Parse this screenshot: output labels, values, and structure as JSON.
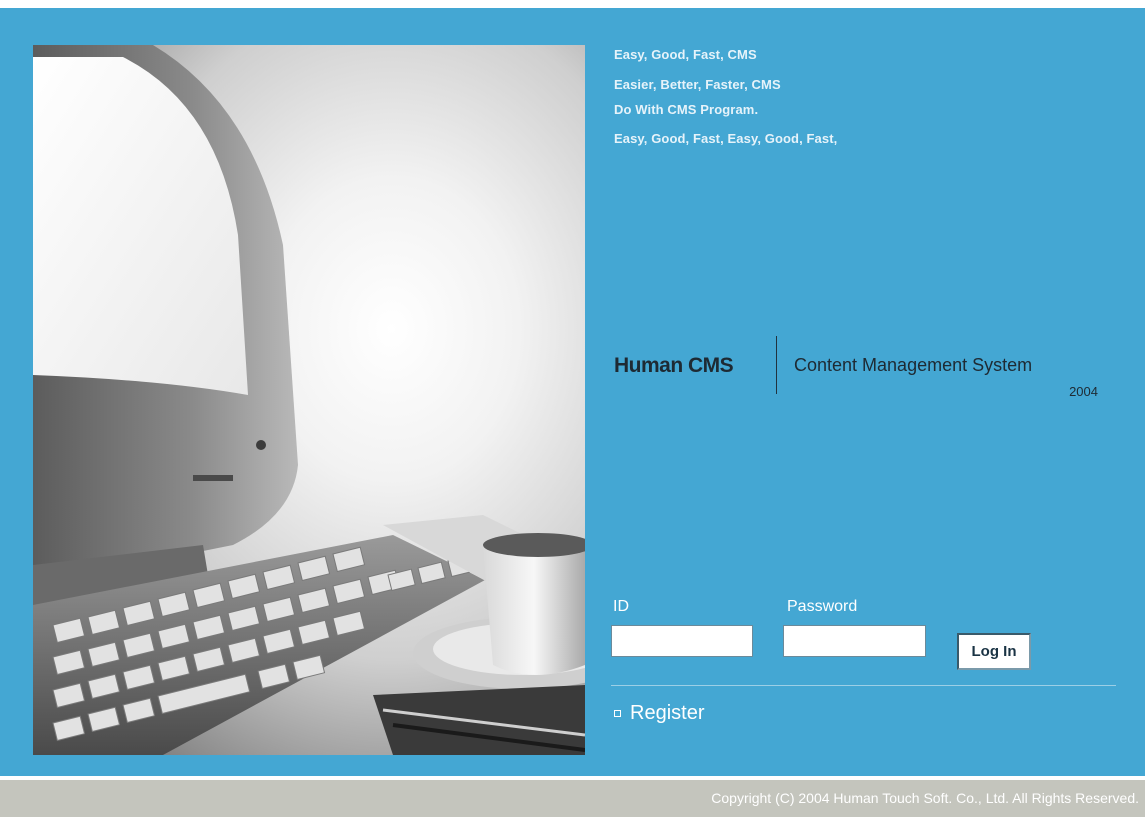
{
  "taglines": [
    "Easy, Good, Fast,  CMS",
    "Easier, Better, Faster,  CMS",
    "Do With CMS Program.",
    "Easy, Good, Fast,  Easy, Good, Fast,"
  ],
  "brand": {
    "name": "Human CMS",
    "subtitle": "Content Management System",
    "year": "2004"
  },
  "login": {
    "id_label": "ID",
    "id_value": "",
    "password_label": "Password",
    "password_value": "",
    "button_label": "Log In"
  },
  "register_label": "Register",
  "footer": {
    "copyright": "Copyright (C) 2004  Human Touch Soft. Co., Ltd. All Rights Reserved."
  },
  "colors": {
    "panel": "#44a7d3",
    "footer": "#c4c5bd",
    "brand_text": "#1e2a33"
  }
}
